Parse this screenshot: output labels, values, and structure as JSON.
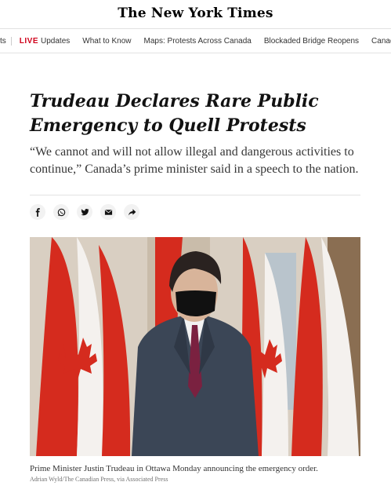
{
  "masthead": {
    "logo": "The New York Times"
  },
  "topnav": {
    "cut_left": "ts",
    "live_badge": "LIVE",
    "items": [
      "Updates",
      "What to Know",
      "Maps: Protests Across Canada",
      "Blockaded Bridge Reopens",
      "Canadians B"
    ]
  },
  "article": {
    "headline": "Trudeau Declares Rare Public Emergency to Quell Protests",
    "summary": "“We cannot and will not allow illegal and dangerous activities to continue,” Canada’s prime minister said in a speech to the nation."
  },
  "share_icons": [
    "facebook-icon",
    "whatsapp-icon",
    "twitter-icon",
    "email-icon",
    "share-arrow-icon"
  ],
  "photo": {
    "caption": "Prime Minister Justin Trudeau in Ottawa Monday announcing the emergency order.",
    "credit": "Adrian Wyld/The Canadian Press, via Associated Press"
  },
  "colors": {
    "live_red": "#d0021b",
    "flag_red": "#d52b1e",
    "suit": "#3b4656",
    "tie": "#7a2140"
  }
}
